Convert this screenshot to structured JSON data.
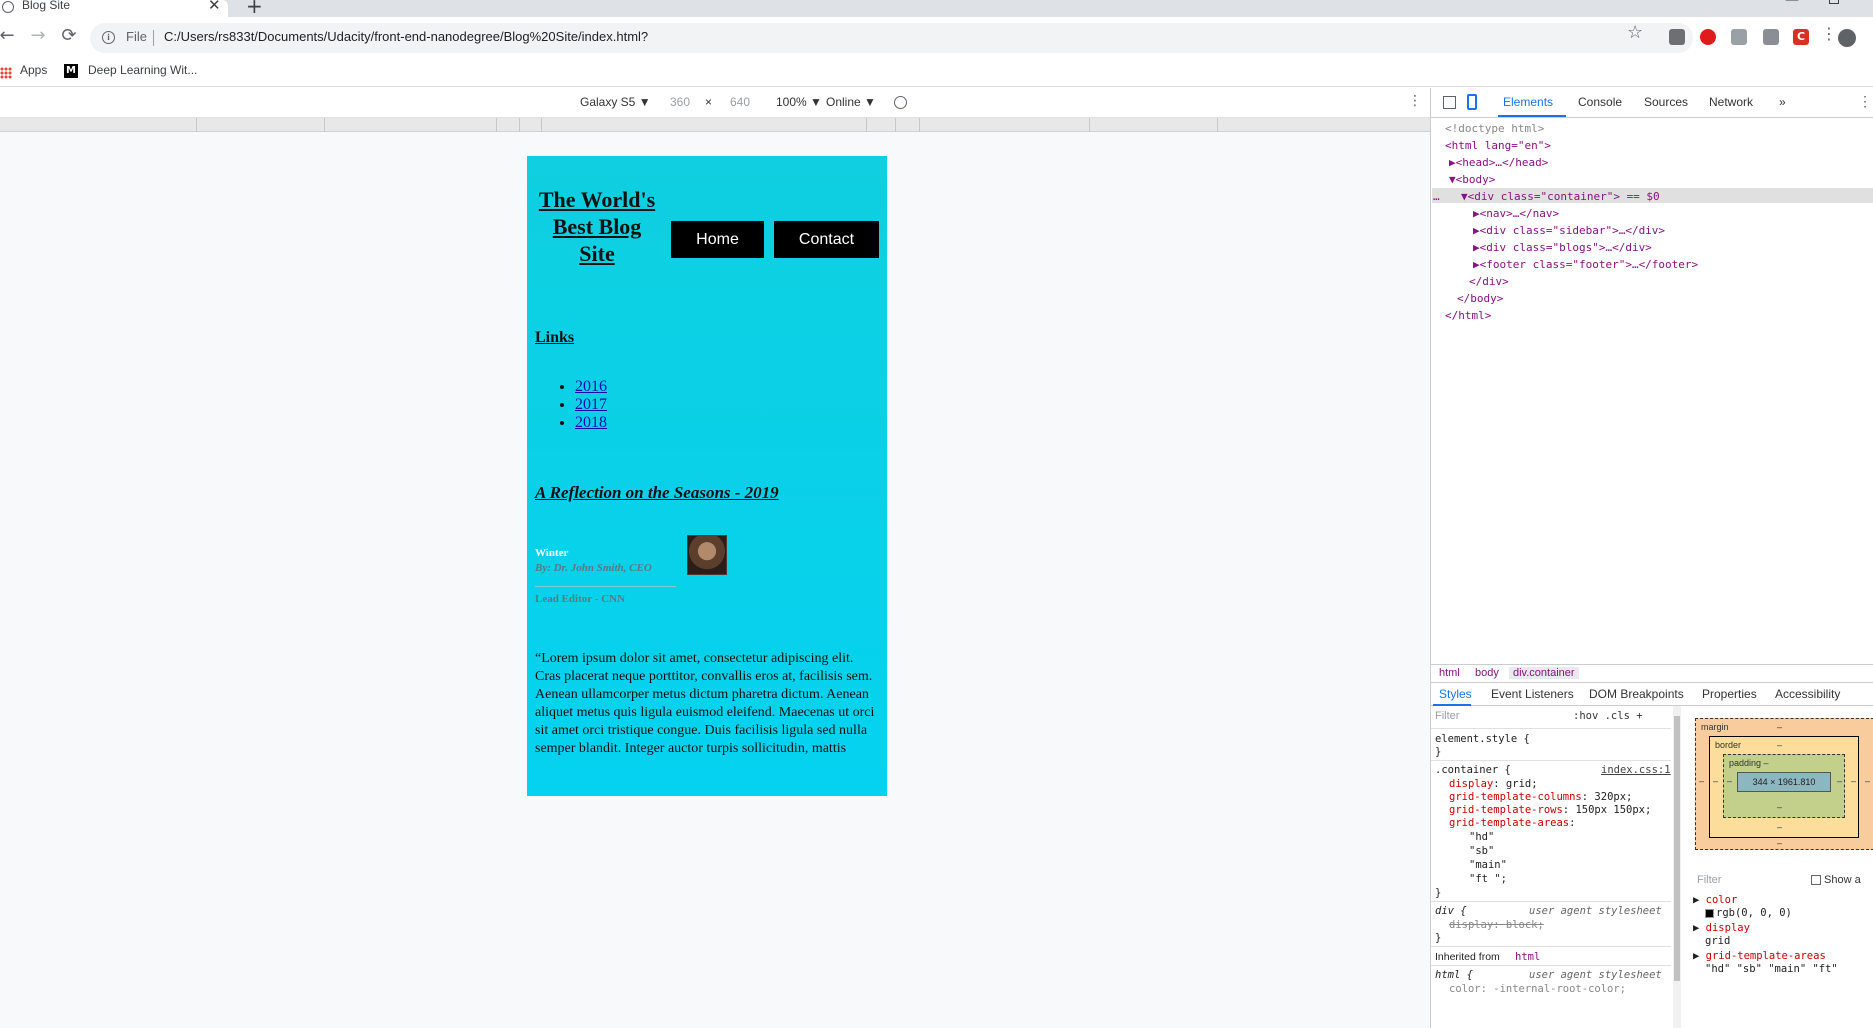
{
  "browser": {
    "tab_title": "Blog Site",
    "tab_close": "✕",
    "new_tab": "+",
    "url_scheme": "File",
    "url": "C:/Users/rs833t/Documents/Udacity/front-end-nanodegree/Blog%20Site/index.html?",
    "bookmarks": [
      {
        "label": "Apps"
      },
      {
        "label": "Deep Learning Wit..."
      }
    ]
  },
  "device_toolbar": {
    "device": "Galaxy S5 ▼",
    "width": "360",
    "times": "×",
    "height": "640",
    "zoom": "100% ▼",
    "network": "Online ▼"
  },
  "site": {
    "title": "The World's Best Blog Site",
    "nav": {
      "home": "Home",
      "contact": "Contact"
    },
    "links_heading": "Links",
    "links": [
      "2016",
      "2017",
      "2018"
    ],
    "post": {
      "title": "A Reflection on the Seasons - 2019",
      "season": "Winter",
      "byline": "By: Dr. John Smith, CEO",
      "role": "Lead Editor - CNN",
      "body": "“Lorem ipsum dolor sit amet, consectetur adipiscing elit. Cras placerat neque porttitor, convallis eros at, facilisis sem. Aenean ullamcorper metus dictum pharetra dictum. Aenean aliquet metus quis ligula euismod eleifend. Maecenas ut orci sit amet orci tristique congue. Duis facilisis ligula sed nulla semper blandit. Integer auctor turpis sollicitudin, mattis"
    }
  },
  "devtools": {
    "tabs": [
      "Elements",
      "Console",
      "Sources",
      "Network",
      "»"
    ],
    "dom": [
      "<!doctype html>",
      "<html lang=\"en\">",
      "▶<head>…</head>",
      "▼<body>",
      "▼<div class=\"container\"> == $0",
      "▶<nav>…</nav>",
      "▶<div class=\"sidebar\">…</div>",
      "▶<div class=\"blogs\">…</div>",
      "▶<footer class=\"footer\">…</footer>",
      "</div>",
      "</body>",
      "</html>"
    ],
    "breadcrumb": [
      "html",
      "body",
      "div.container"
    ],
    "sub_tabs": [
      "Styles",
      "Event Listeners",
      "DOM Breakpoints",
      "Properties",
      "Accessibility"
    ],
    "styles": {
      "filter_placeholder": "Filter",
      "hov": ":hov  .cls  +",
      "element_style": "element.style {",
      "element_style_close": "}",
      "container_selector": ".container {",
      "container_src": "index.css:1",
      "decls": [
        {
          "prop": "display",
          "val": "grid;"
        },
        {
          "prop": "grid-template-columns",
          "val": "320px;"
        },
        {
          "prop": "grid-template-rows",
          "val": "150px 150px;"
        },
        {
          "prop": "grid-template-areas",
          "val": ""
        }
      ],
      "areas": [
        "\"hd\"",
        "\"sb\"",
        "\"main\"",
        "\"ft \";"
      ],
      "close": "}",
      "div_selector": "div {",
      "div_src": "user agent stylesheet",
      "div_decl": "display: block;",
      "inherited": "Inherited from",
      "inherited_tag": "html",
      "html_selector": "html {",
      "html_src": "user agent stylesheet",
      "html_decl": "color: -internal-root-color;"
    },
    "boxmodel": {
      "margin": "margin",
      "border": "border",
      "padding": "padding –",
      "dash": "–",
      "content": "344 × 1961.810"
    },
    "computed": {
      "filter": "Filter",
      "show_all": "Show a",
      "props": [
        {
          "name": "color",
          "value": "rgb(0, 0, 0)"
        },
        {
          "name": "display",
          "value": "grid"
        },
        {
          "name": "grid-template-areas",
          "value": "\"hd\" \"sb\" \"main\" \"ft\""
        }
      ]
    }
  }
}
